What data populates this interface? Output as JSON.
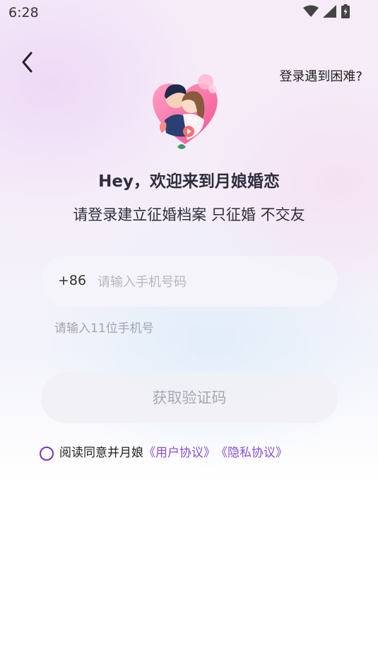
{
  "status_bar": {
    "time": "6:28"
  },
  "header": {
    "help_link": "登录遇到困难?"
  },
  "welcome": {
    "title": "Hey，欢迎来到月娘婚恋",
    "subtitle": "请登录建立征婚档案 只征婚 不交友"
  },
  "phone": {
    "country_code": "+86",
    "placeholder": "请输入手机号码",
    "value": "",
    "hint": "请输入11位手机号"
  },
  "get_code_label": "获取验证码",
  "agreement": {
    "prefix": "阅读同意并月娘",
    "user_agreement": "《用户协议》",
    "privacy_agreement": "《隐私协议》",
    "checked": false
  },
  "colors": {
    "accent": "#8a4fd0",
    "radio_border": "#7a32b8"
  },
  "icons": [
    "wifi-icon",
    "signal-icon",
    "battery-icon",
    "back-arrow-icon",
    "couple-heart-illustration"
  ]
}
